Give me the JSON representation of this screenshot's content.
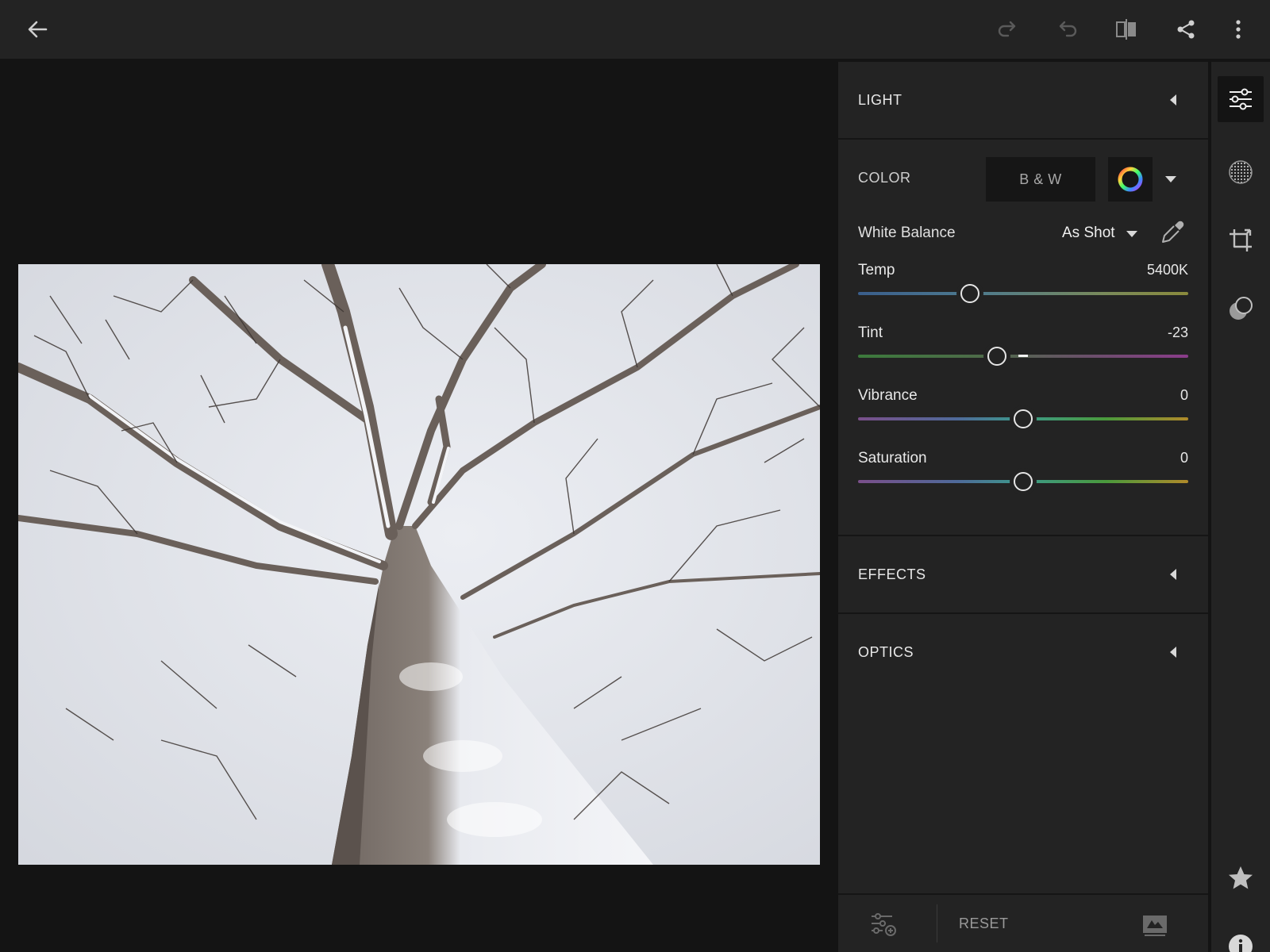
{
  "toolbar": {
    "back_icon": "arrow-left-icon",
    "redo_icon": "redo-icon",
    "undo_icon": "undo-icon",
    "compare_icon": "before-after-icon",
    "share_icon": "share-icon",
    "more_icon": "more-vertical-icon"
  },
  "panel": {
    "light": {
      "title": "LIGHT"
    },
    "color": {
      "title": "COLOR",
      "bw_label": "B & W",
      "white_balance_label": "White Balance",
      "white_balance_value": "As Shot",
      "sliders": [
        {
          "label": "Temp",
          "value": "5400K",
          "position": 0.34
        },
        {
          "label": "Tint",
          "value": "-23",
          "position": 0.42
        },
        {
          "label": "Vibrance",
          "value": "0",
          "position": 0.5
        },
        {
          "label": "Saturation",
          "value": "0",
          "position": 0.5
        }
      ]
    },
    "effects": {
      "title": "EFFECTS"
    },
    "optics": {
      "title": "OPTICS"
    },
    "bottom": {
      "reset_label": "RESET"
    }
  },
  "tools": [
    {
      "name": "edit-sliders-icon",
      "active": true
    },
    {
      "name": "selective-mask-icon",
      "active": false
    },
    {
      "name": "crop-icon",
      "active": false
    },
    {
      "name": "healing-icon",
      "active": false
    },
    {
      "name": "star-icon",
      "active": false
    },
    {
      "name": "info-icon",
      "active": false
    }
  ],
  "colors": {
    "background": "#141414",
    "panel": "#232323",
    "text": "#e8e8e8"
  }
}
